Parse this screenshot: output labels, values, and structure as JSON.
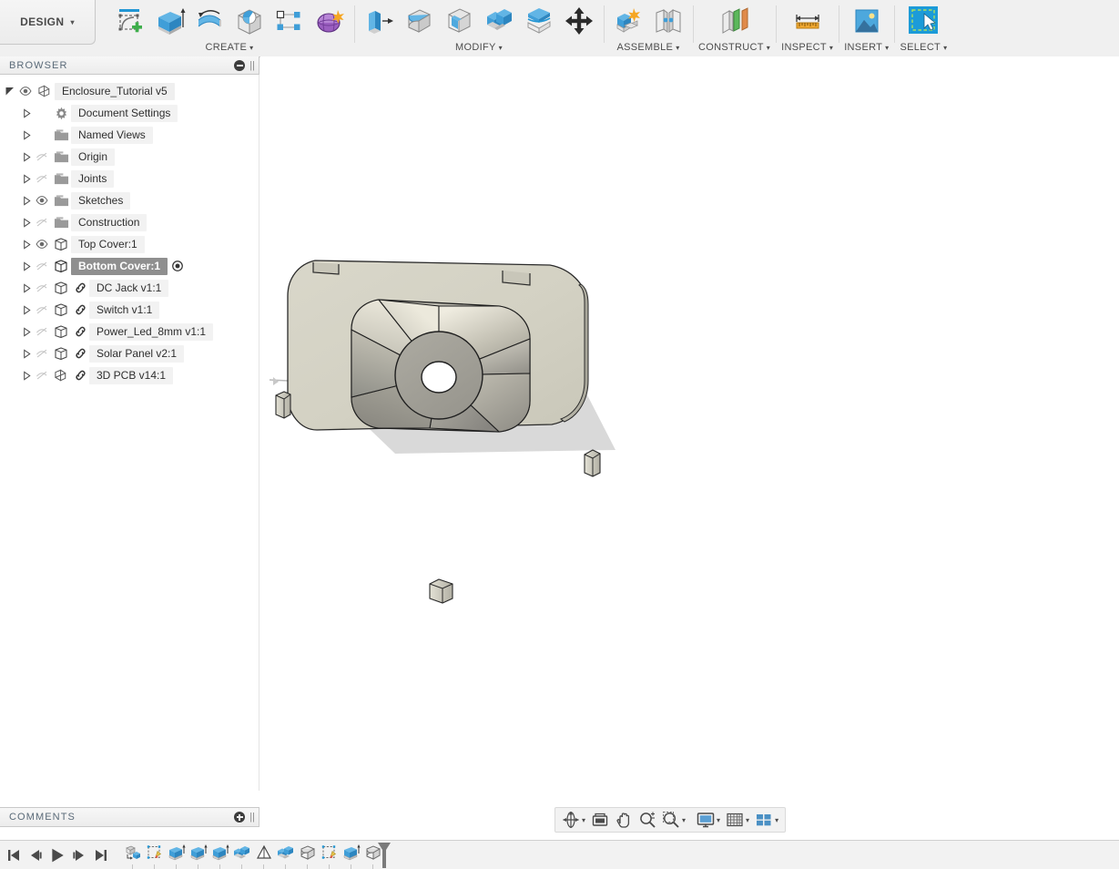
{
  "app": {
    "workspace_tab": "DESIGN",
    "workspace_caret": "▾"
  },
  "ribbon": {
    "groups": [
      {
        "name": "create",
        "label": "CREATE",
        "caret": "▾",
        "icons": [
          {
            "name": "create-sketch-icon",
            "title": "Create Sketch"
          },
          {
            "name": "extrude-icon",
            "title": "Extrude"
          },
          {
            "name": "revolve-icon",
            "title": "Revolve"
          },
          {
            "name": "hole-icon",
            "title": "Hole"
          },
          {
            "name": "rectangular-pattern-icon",
            "title": "Rectangular Pattern"
          },
          {
            "name": "create-form-icon",
            "title": "Create Form"
          }
        ]
      },
      {
        "name": "modify",
        "label": "MODIFY",
        "caret": "▾",
        "icons": [
          {
            "name": "press-pull-icon",
            "title": "Press Pull"
          },
          {
            "name": "fillet-icon",
            "title": "Fillet"
          },
          {
            "name": "shell-icon",
            "title": "Shell"
          },
          {
            "name": "combine-icon",
            "title": "Combine"
          },
          {
            "name": "split-face-icon",
            "title": "Split Face"
          },
          {
            "name": "move-copy-icon",
            "title": "Move/Copy"
          }
        ]
      },
      {
        "name": "assemble",
        "label": "ASSEMBLE",
        "caret": "▾",
        "icons": [
          {
            "name": "new-component-icon",
            "title": "New Component"
          },
          {
            "name": "joint-icon",
            "title": "Joint"
          }
        ]
      },
      {
        "name": "construct",
        "label": "CONSTRUCT",
        "caret": "▾",
        "icons": [
          {
            "name": "offset-plane-icon",
            "title": "Offset Plane"
          }
        ]
      },
      {
        "name": "inspect",
        "label": "INSPECT",
        "caret": "▾",
        "icons": [
          {
            "name": "measure-icon",
            "title": "Measure"
          }
        ]
      },
      {
        "name": "insert",
        "label": "INSERT",
        "caret": "▾",
        "icons": [
          {
            "name": "insert-image-icon",
            "title": "Canvas"
          }
        ]
      },
      {
        "name": "select",
        "label": "SELECT",
        "caret": "▾",
        "icons": [
          {
            "name": "select-window-icon",
            "title": "Select"
          }
        ]
      }
    ]
  },
  "browser": {
    "title": "BROWSER",
    "collapse_icon": "minus-circle-icon",
    "grip_icon": "panel-grip-icon",
    "tree": [
      {
        "label": "Enclosure_Tutorial v5",
        "indent": 0,
        "expander": "down",
        "eye": "visible",
        "icon": "document-icon",
        "link": false,
        "selected": false
      },
      {
        "label": "Document Settings",
        "indent": 1,
        "expander": "right",
        "eye": "none",
        "icon": "gear-icon",
        "link": false,
        "selected": false
      },
      {
        "label": "Named Views",
        "indent": 1,
        "expander": "right",
        "eye": "none",
        "icon": "folder-icon",
        "link": false,
        "selected": false
      },
      {
        "label": "Origin",
        "indent": 1,
        "expander": "right",
        "eye": "hidden",
        "icon": "folder-icon",
        "link": false,
        "selected": false
      },
      {
        "label": "Joints",
        "indent": 1,
        "expander": "right",
        "eye": "hidden",
        "icon": "folder-icon",
        "link": false,
        "selected": false
      },
      {
        "label": "Sketches",
        "indent": 1,
        "expander": "right",
        "eye": "visible",
        "icon": "folder-icon",
        "link": false,
        "selected": false
      },
      {
        "label": "Construction",
        "indent": 1,
        "expander": "right",
        "eye": "hidden",
        "icon": "folder-icon",
        "link": false,
        "selected": false
      },
      {
        "label": "Top Cover:1",
        "indent": 1,
        "expander": "right",
        "eye": "visible",
        "icon": "body-icon",
        "link": false,
        "selected": false
      },
      {
        "label": "Bottom Cover:1",
        "indent": 1,
        "expander": "right",
        "eye": "hidden",
        "icon": "body-icon",
        "link": false,
        "selected": true
      },
      {
        "label": "DC Jack v1:1",
        "indent": 1,
        "expander": "right",
        "eye": "hidden",
        "icon": "body-icon",
        "link": true,
        "selected": false
      },
      {
        "label": "Switch v1:1",
        "indent": 1,
        "expander": "right",
        "eye": "hidden",
        "icon": "body-icon",
        "link": true,
        "selected": false
      },
      {
        "label": "Power_Led_8mm v1:1",
        "indent": 1,
        "expander": "right",
        "eye": "hidden",
        "icon": "body-icon",
        "link": true,
        "selected": false
      },
      {
        "label": "Solar Panel v2:1",
        "indent": 1,
        "expander": "right",
        "eye": "hidden",
        "icon": "body-icon",
        "link": true,
        "selected": false
      },
      {
        "label": "3D PCB v14:1",
        "indent": 1,
        "expander": "right",
        "eye": "hidden",
        "icon": "component-icon",
        "link": true,
        "selected": false
      }
    ]
  },
  "comments": {
    "title": "COMMENTS",
    "add_icon": "plus-circle-icon",
    "grip_icon": "panel-grip-icon"
  },
  "navbar": {
    "buttons": [
      {
        "name": "orbit-button",
        "icon": "orbit-icon",
        "caret": "▾"
      },
      {
        "name": "look-at-button",
        "icon": "look-at-icon",
        "caret": ""
      },
      {
        "name": "pan-button",
        "icon": "pan-hand-icon",
        "caret": ""
      },
      {
        "name": "zoom-button",
        "icon": "zoom-icon",
        "caret": ""
      },
      {
        "name": "zoom-window-button",
        "icon": "zoom-window-icon",
        "caret": "▾"
      },
      {
        "name": "display-settings-button",
        "icon": "display-settings-icon",
        "caret": "▾"
      },
      {
        "name": "grid-snaps-button",
        "icon": "grid-snaps-icon",
        "caret": "▾"
      },
      {
        "name": "viewports-button",
        "icon": "viewports-icon",
        "caret": "▾"
      }
    ]
  },
  "timeline": {
    "controls": [
      {
        "name": "go-to-beginning-button",
        "icon": "skip-start-icon"
      },
      {
        "name": "step-back-button",
        "icon": "step-back-icon"
      },
      {
        "name": "play-button",
        "icon": "play-icon"
      },
      {
        "name": "step-forward-button",
        "icon": "step-forward-icon"
      },
      {
        "name": "go-to-end-button",
        "icon": "skip-end-icon"
      }
    ],
    "features": [
      {
        "name": "timeline-feature-component",
        "icon": "new-component-icon"
      },
      {
        "name": "timeline-feature-sketch",
        "icon": "sketch-icon"
      },
      {
        "name": "timeline-feature-extrude",
        "icon": "extrude-icon"
      },
      {
        "name": "timeline-feature-extrude",
        "icon": "extrude-icon"
      },
      {
        "name": "timeline-feature-extrude",
        "icon": "extrude-icon"
      },
      {
        "name": "timeline-feature-combine",
        "icon": "combine-icon"
      },
      {
        "name": "timeline-feature-draft",
        "icon": "draft-icon"
      },
      {
        "name": "timeline-feature-combine",
        "icon": "combine-icon"
      },
      {
        "name": "timeline-feature-fillet",
        "icon": "fillet-icon"
      },
      {
        "name": "timeline-feature-sketch",
        "icon": "sketch-icon"
      },
      {
        "name": "timeline-feature-extrude",
        "icon": "extrude-icon"
      },
      {
        "name": "timeline-feature-fillet",
        "icon": "fillet-icon"
      }
    ],
    "marker": {
      "name": "timeline-marker",
      "icon": "timeline-marker-icon"
    }
  },
  "viewport": {
    "model_name": "bottom-cover-3d-model",
    "background": "#ffffff",
    "body_color": "#d4d2c4",
    "funnel_light": "#e6e2d7",
    "funnel_dark": "#9b9b93",
    "hub_color": "#a0a09a",
    "shadow_color": "#d6d6d6",
    "edge_color": "#2a2a2a"
  }
}
